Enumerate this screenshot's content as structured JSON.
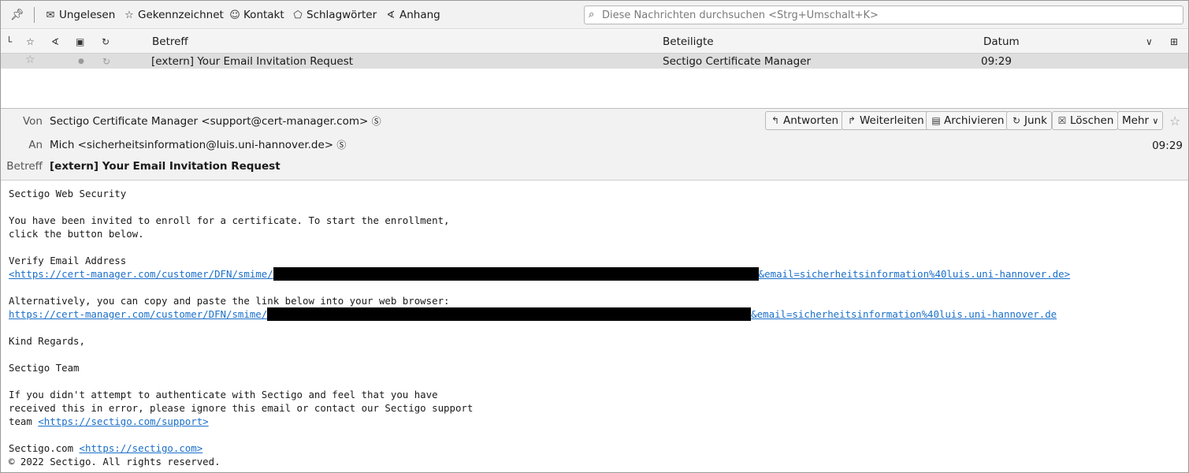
{
  "filterbar": {
    "pin_icon": "pin-icon",
    "buttons": [
      {
        "icon": "unread-icon",
        "label": "Ungelesen"
      },
      {
        "icon": "star-icon",
        "label": "Gekennzeichnet"
      },
      {
        "icon": "contact-icon",
        "label": "Kontakt"
      },
      {
        "icon": "tag-icon",
        "label": "Schlagwörter"
      },
      {
        "icon": "attachment-icon",
        "label": "Anhang"
      }
    ],
    "search_placeholder": "Diese Nachrichten durchsuchen <Strg+Umschalt+K>"
  },
  "thread_list": {
    "columns": {
      "subject": "Betreff",
      "participants": "Beteiligte",
      "date": "Datum"
    },
    "rows": [
      {
        "subject": "[extern] Your Email Invitation Request",
        "participants": "Sectigo Certificate Manager",
        "date": "09:29"
      }
    ]
  },
  "message": {
    "from_label": "Von",
    "from": "Sectigo Certificate Manager <support@cert-manager.com>",
    "to_label": "An",
    "to": "Mich <sicherheitsinformation@luis.uni-hannover.de>",
    "subject_label": "Betreff",
    "subject": "[extern] Your Email Invitation Request",
    "time": "09:29",
    "actions": {
      "reply": "Antworten",
      "forward": "Weiterleiten",
      "archive": "Archivieren",
      "junk": "Junk",
      "delete": "Löschen",
      "more": "Mehr"
    }
  },
  "body": {
    "line1": "Sectigo Web Security",
    "line2": "You have been invited to enroll for a certificate. To start the enrollment,",
    "line3": "click the button below.",
    "line4": "Verify Email Address",
    "link1_start": "<https://cert-manager.com/customer/DFN/smime/",
    "link1_end": "&email=sicherheitsinformation%40luis.uni-hannover.de>",
    "line5": "Alternatively, you can copy and paste the link below into your web browser:",
    "link2_start": "https://cert-manager.com/customer/DFN/smime/",
    "link2_end": "&email=sicherheitsinformation%40luis.uni-hannover.de",
    "line6": "Kind Regards,",
    "line7": "Sectigo Team",
    "line8": "If you didn't attempt to authenticate with Sectigo and feel that you have",
    "line9": "received this in error, please ignore this email or contact our Sectigo support",
    "line10_text": "team ",
    "line10_link": "<https://sectigo.com/support>",
    "line11_text": "Sectigo.com ",
    "line11_link": "<https://sectigo.com>",
    "line12": "© 2022 Sectigo. All rights reserved."
  }
}
